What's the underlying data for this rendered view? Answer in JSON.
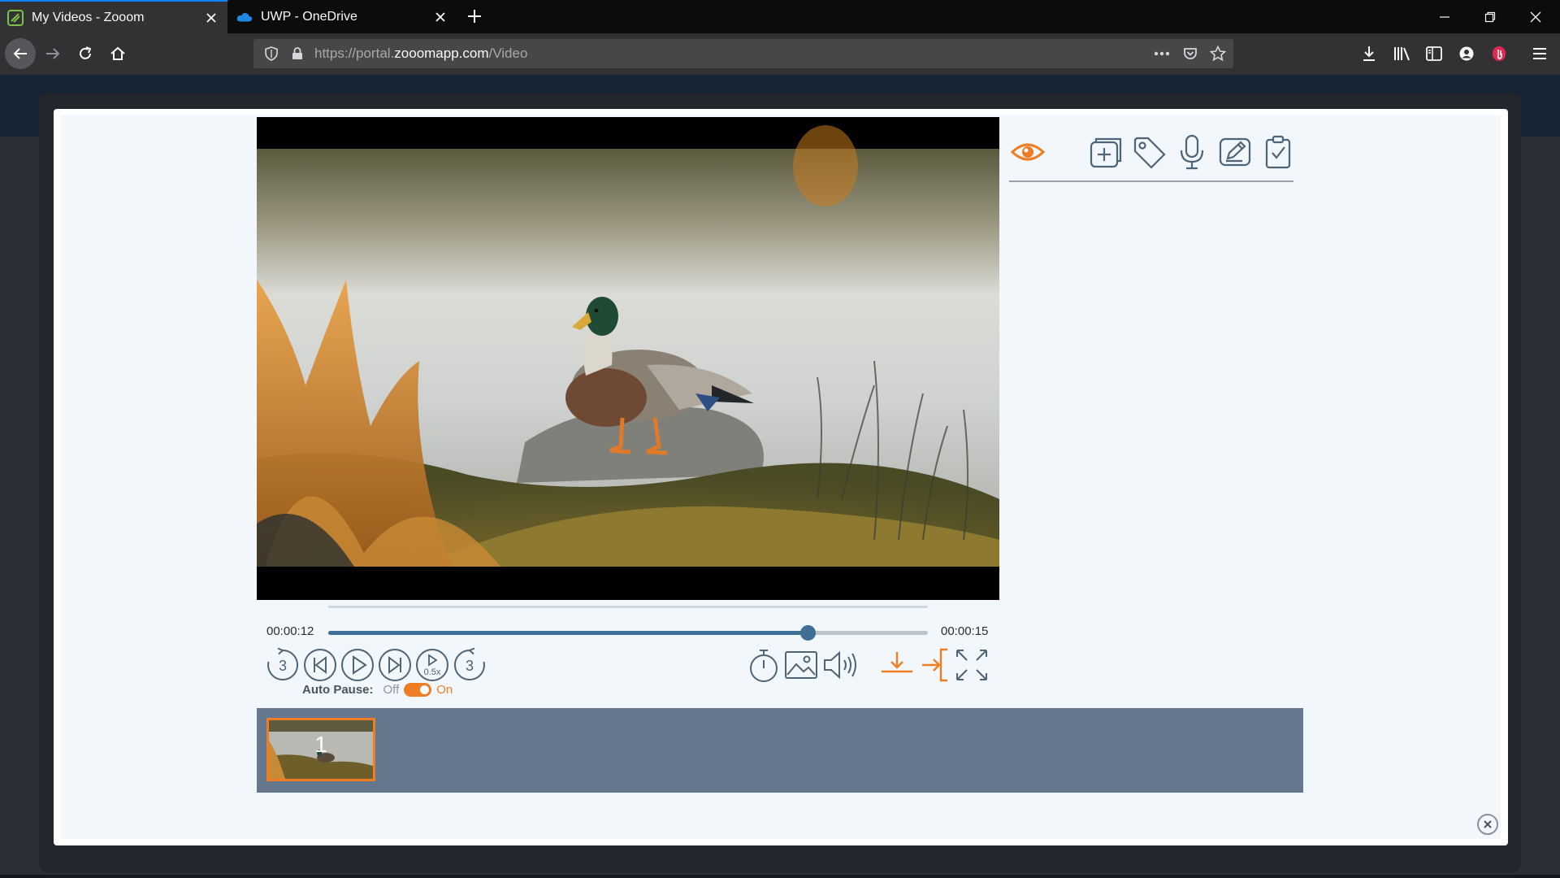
{
  "browser": {
    "tabs": [
      {
        "title": "My Videos - Zooom",
        "active": true,
        "favicon": "zooom-favicon"
      },
      {
        "title": "UWP - OneDrive",
        "active": false,
        "favicon": "onedrive-favicon"
      }
    ],
    "url": {
      "prefix": "https://portal.",
      "domain": "zooomapp.com",
      "path": "/Video"
    }
  },
  "player": {
    "current_time": "00:00:12",
    "duration": "00:00:15",
    "progress_fraction": 0.8,
    "rewind_seconds": "3",
    "forward_seconds": "3",
    "speed_label": "0.5x",
    "auto_pause": {
      "label": "Auto Pause:",
      "off_label": "Off",
      "on_label": "On",
      "enabled": true
    }
  },
  "side_tools": [
    "eye-icon",
    "add-note-icon",
    "tag-icon",
    "microphone-icon",
    "pencil-icon",
    "clipboard-check-icon"
  ],
  "filmstrip": {
    "thumbnails": [
      {
        "number": "1",
        "selected": true
      }
    ]
  },
  "colors": {
    "accent_orange": "#ef7d24",
    "player_blue": "#3f6f95",
    "icon_slate": "#4e6478",
    "strip_bg": "#64778c"
  }
}
